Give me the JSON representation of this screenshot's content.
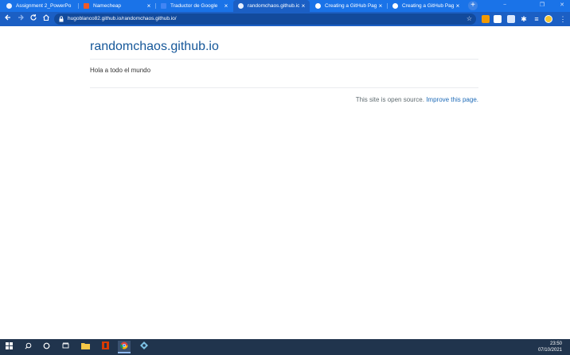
{
  "browser": {
    "tabs": [
      {
        "title": "Assignment 2_PowerPo",
        "favicon": "powerpoint-icon",
        "color": "#e8f0fe"
      },
      {
        "title": "Namecheap",
        "favicon": "namecheap-icon",
        "color": "#f05a28"
      },
      {
        "title": "Traductor de Google",
        "favicon": "google-translate-icon",
        "color": "#4285f4"
      },
      {
        "title": "randomchaos.github.io |",
        "favicon": "globe-icon",
        "color": "#e8f0fe"
      },
      {
        "title": "Creating a GitHub Page",
        "favicon": "github-icon",
        "color": "#ffffff"
      },
      {
        "title": "Creating a GitHub Page",
        "favicon": "github-icon",
        "color": "#ffffff"
      }
    ],
    "active_tab_index": 3,
    "new_tab_label": "+",
    "close_glyph": "×",
    "url": "hugoblanco82.github.io/randomchaos.github.io/",
    "window_controls": {
      "minimize": "−",
      "maximize": "❐",
      "close": "✕"
    }
  },
  "page": {
    "site_title": "randomchaos.github.io",
    "content_text": "Hola a todo el mundo",
    "footer_text": "This site is open source.",
    "footer_link": "Improve this page."
  },
  "taskbar": {
    "time": "23:50",
    "date": "07/10/2021"
  },
  "colors": {
    "brand_blue": "#1a73e8",
    "title_blue": "#155799",
    "link_blue": "#1e6bb8",
    "taskbar": "#20344d"
  }
}
